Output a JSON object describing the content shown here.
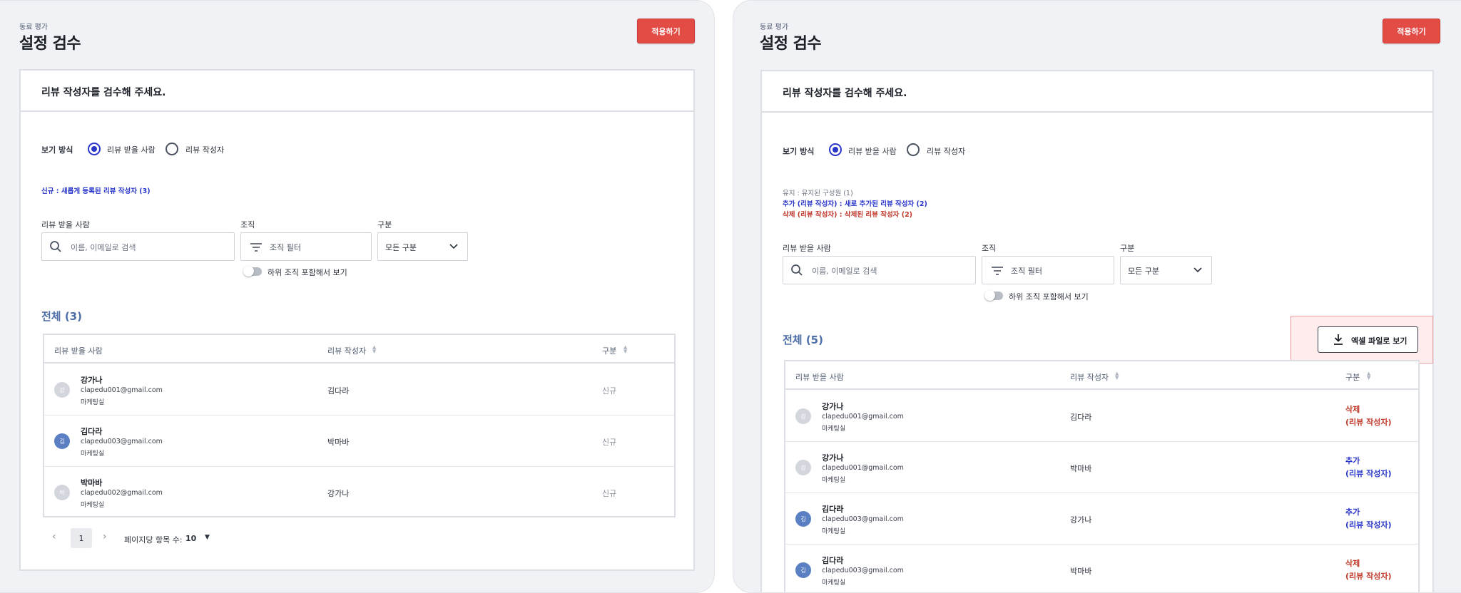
{
  "left": {
    "breadcrumb": "동료 평가",
    "title": "설정 검수",
    "apply_label": "적용하기",
    "card_title": "리뷰 작성자를 검수해 주세요.",
    "view_mode_label": "보기 방식",
    "radio_receiver": "리뷰 받을 사람",
    "radio_writer": "리뷰 작성자",
    "notes": [
      "신규 : 새롭게 등록된 리뷰 작성자 (3)"
    ],
    "filter_receiver_label": "리뷰 받을 사람",
    "search_placeholder": "이름, 이메일로 검색",
    "filter_org_label": "조직",
    "org_placeholder": "조직 필터",
    "filter_type_label": "구분",
    "type_value": "모든 구분",
    "toggle_label": "하위 조직 포함해서 보기",
    "total": "전체 (3)",
    "columns": [
      "리뷰 받을 사람",
      "리뷰 작성자",
      "구분"
    ],
    "rows": [
      {
        "avatar": "강",
        "name": "강가나",
        "email": "clapedu001@gmail.com",
        "dept": "마케팅실",
        "writer": "김다라",
        "type": "신규"
      },
      {
        "avatar": "김",
        "name": "김다라",
        "email": "clapedu003@gmail.com",
        "dept": "마케팅실",
        "writer": "박마바",
        "type": "신규"
      },
      {
        "avatar": "박",
        "name": "박마바",
        "email": "clapedu002@gmail.com",
        "dept": "마케팅실",
        "writer": "강가나",
        "type": "신규"
      }
    ],
    "pagination": {
      "current": "1",
      "per_page_label": "페이지당 항목 수:",
      "per_page_value": "10"
    }
  },
  "right": {
    "breadcrumb": "동료 평가",
    "title": "설정 검수",
    "apply_label": "적용하기",
    "card_title": "리뷰 작성자를 검수해 주세요.",
    "view_mode_label": "보기 방식",
    "radio_receiver": "리뷰 받을 사람",
    "radio_writer": "리뷰 작성자",
    "notes": [
      "유지 : 유지된 구성원 (1)",
      "추가 (리뷰 작성자) : 새로 추가된 리뷰 작성자 (2)",
      "삭제 (리뷰 작성자) : 삭제된 리뷰 작성자 (2)"
    ],
    "filter_receiver_label": "리뷰 받을 사람",
    "search_placeholder": "이름, 이메일로 검색",
    "filter_org_label": "조직",
    "org_placeholder": "조직 필터",
    "filter_type_label": "구분",
    "type_value": "모든 구분",
    "toggle_label": "하위 조직 포함해서 보기",
    "total": "전체 (5)",
    "excel_label": "엑셀 파일로 보기",
    "columns": [
      "리뷰 받을 사람",
      "리뷰 작성자",
      "구분"
    ],
    "rows": [
      {
        "avatar": "강",
        "name": "강가나",
        "email": "clapedu001@gmail.com",
        "dept": "마케팅실",
        "writer": "김다라",
        "type1": "삭제",
        "type2": "(리뷰 작성자)"
      },
      {
        "avatar": "강",
        "name": "강가나",
        "email": "clapedu001@gmail.com",
        "dept": "마케팅실",
        "writer": "박마바",
        "type1": "추가",
        "type2": "(리뷰 작성자)"
      },
      {
        "avatar": "김",
        "name": "김다라",
        "email": "clapedu003@gmail.com",
        "dept": "마케팅실",
        "writer": "강가나",
        "type1": "추가",
        "type2": "(리뷰 작성자)"
      },
      {
        "avatar": "김",
        "name": "김다라",
        "email": "clapedu003@gmail.com",
        "dept": "마케팅실",
        "writer": "박마바",
        "type1": "삭제",
        "type2": "(리뷰 작성자)"
      }
    ]
  },
  "colors": {
    "accent_red": "#e34b45",
    "radio_blue": "#2936c9",
    "total_blue": "#4d6ea6",
    "delete_red": "#c0392b"
  },
  "icons": [
    "search-icon",
    "filter-icon",
    "chevron-down-icon",
    "sort-icon",
    "download-icon",
    "chevron-left-icon",
    "chevron-right-icon",
    "caret-down-icon"
  ]
}
